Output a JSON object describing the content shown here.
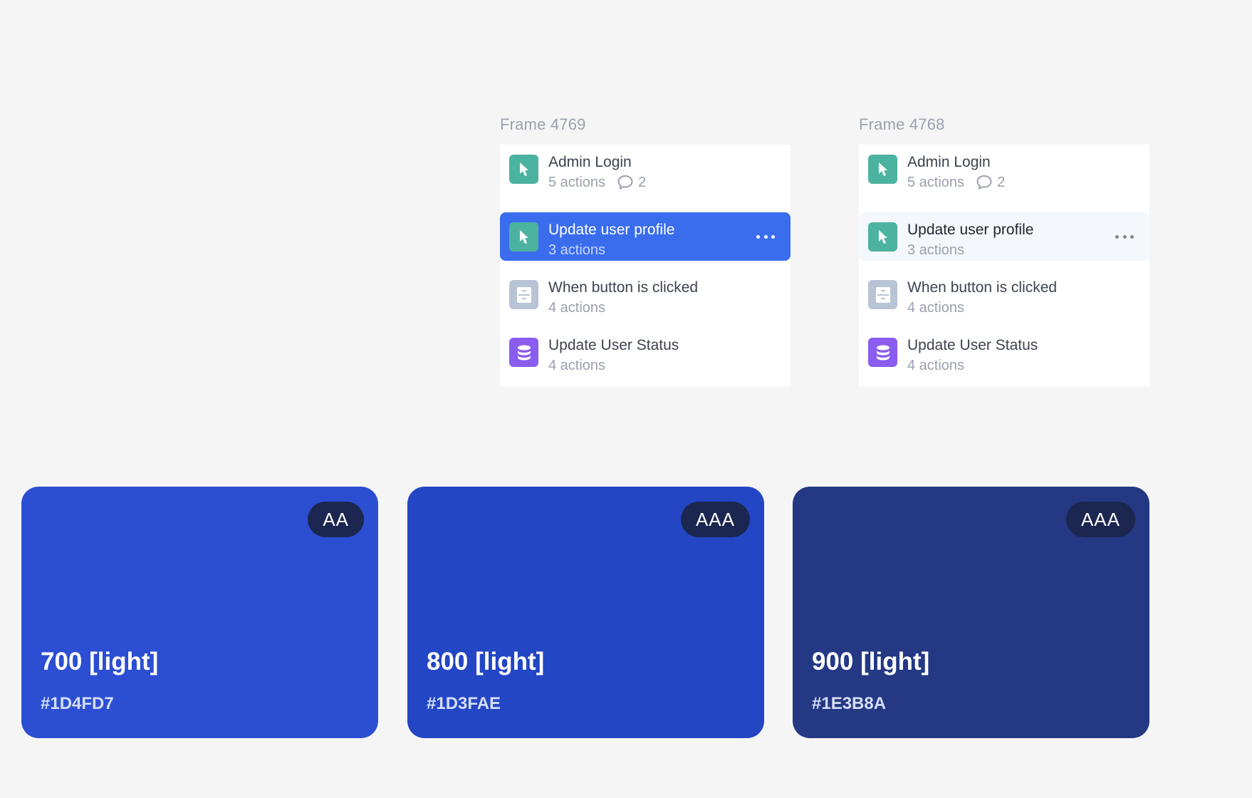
{
  "frames": [
    {
      "title": "Frame 4769",
      "items": [
        {
          "title": "Admin Login",
          "subtitle": "5 actions",
          "comments": "2",
          "icon": "cursor-icon",
          "color": "#4CB3A0"
        },
        {
          "title": "Update user profile",
          "subtitle": "3 actions",
          "icon": "cursor-icon",
          "color": "#4CB3A0",
          "state": "selected"
        },
        {
          "title": "When button is clicked",
          "subtitle": "4 actions",
          "icon": "form-icon",
          "color": "#B9C3D6"
        },
        {
          "title": "Update User Status",
          "subtitle": "4 actions",
          "icon": "database-icon",
          "color": "#8A5CF0"
        }
      ]
    },
    {
      "title": "Frame 4768",
      "items": [
        {
          "title": "Admin Login",
          "subtitle": "5 actions",
          "comments": "2",
          "icon": "cursor-icon",
          "color": "#4CB3A0"
        },
        {
          "title": "Update user profile",
          "subtitle": "3 actions",
          "icon": "cursor-icon",
          "color": "#4CB3A0",
          "state": "hover"
        },
        {
          "title": "When button is clicked",
          "subtitle": "4 actions",
          "icon": "form-icon",
          "color": "#B9C3D6"
        },
        {
          "title": "Update User Status",
          "subtitle": "4 actions",
          "icon": "database-icon",
          "color": "#8A5CF0"
        }
      ]
    }
  ],
  "swatches": [
    {
      "name": "700 [light]",
      "hex": "#1D4FD7",
      "badge": "AA",
      "fill": "#2B4ED2"
    },
    {
      "name": "800 [light]",
      "hex": "#1D3FAE",
      "badge": "AAA",
      "fill": "#2346C4"
    },
    {
      "name": "900 [light]",
      "hex": "#1E3B8A",
      "badge": "AAA",
      "fill": "#243884"
    }
  ],
  "accent_selected": "#3A6DED",
  "badge_background": "#1B2750"
}
